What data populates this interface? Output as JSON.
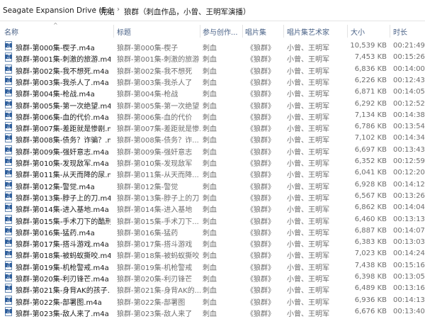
{
  "breadcrumb": [
    "Seagate Expansion Drive (E:)",
    "完结",
    "狼群（刺血作品，小曾、王明军演播）"
  ],
  "breadcrumb_separator": "›",
  "columns": {
    "name": "名称",
    "title": "标题",
    "artist": "参与创作...",
    "album": "唱片集",
    "album_artist": "唱片集艺术家",
    "size": "大小",
    "length": "时长",
    "sort_indicator": "^"
  },
  "icon": "audio-file-icon",
  "accent": "#2f5f9c",
  "files": [
    {
      "name": "狼群-第000集-楔子.m4a",
      "title": "狼群-第000集-楔子",
      "artist": "刺血",
      "album": "《狼群》",
      "album_artist": "小曾、王明军",
      "size": "10,539 KB",
      "length": "00:21:49"
    },
    {
      "name": "狼群-第001集-刺激的旅游.m4a",
      "title": "狼群-第001集-刺激的旅游",
      "artist": "刺血",
      "album": "《狼群》",
      "album_artist": "小曾、王明军",
      "size": "7,453 KB",
      "length": "00:15:26"
    },
    {
      "name": "狼群-第002集-我不想死.m4a",
      "title": "狼群-第002集-我不想死",
      "artist": "刺血",
      "album": "《狼群》",
      "album_artist": "小曾、王明军",
      "size": "6,836 KB",
      "length": "00:14:00"
    },
    {
      "name": "狼群-第003集-我杀人了.m4a",
      "title": "狼群-第003集-我杀人了",
      "artist": "刺血",
      "album": "《狼群》",
      "album_artist": "小曾、王明军",
      "size": "6,226 KB",
      "length": "00:12:43"
    },
    {
      "name": "狼群-第004集-枪战.m4a",
      "title": "狼群-第004集-枪战",
      "artist": "刺血",
      "album": "《狼群》",
      "album_artist": "小曾、王明军",
      "size": "6,871 KB",
      "length": "00:14:05"
    },
    {
      "name": "狼群-第005集-第一次绝望.m4a",
      "title": "狼群-第005集-第一次绝望",
      "artist": "刺血",
      "album": "《狼群》",
      "album_artist": "小曾、王明军",
      "size": "6,292 KB",
      "length": "00:12:52"
    },
    {
      "name": "狼群-第006集-血的代价.m4a",
      "title": "狼群-第006集-血的代价",
      "artist": "刺血",
      "album": "《狼群》",
      "album_artist": "小曾、王明军",
      "size": "7,134 KB",
      "length": "00:14:38"
    },
    {
      "name": "狼群-第007集-差距就是惨剧.m...",
      "title": "狼群-第007集-差距就是惨...",
      "artist": "刺血",
      "album": "《狼群》",
      "album_artist": "小曾、王明军",
      "size": "6,786 KB",
      "length": "00:13:54"
    },
    {
      "name": "狼群-第008集-债务？诈骗？.m...",
      "title": "狼群-第008集-债务？诈...",
      "artist": "刺血",
      "album": "《狼群》",
      "album_artist": "小曾、王明军",
      "size": "7,102 KB",
      "length": "00:14:34"
    },
    {
      "name": "狼群-第009集-强奸意志.m4a",
      "title": "狼群-第009集-强奸意志",
      "artist": "刺血",
      "album": "《狼群》",
      "album_artist": "小曾、王明军",
      "size": "6,697 KB",
      "length": "00:13:43"
    },
    {
      "name": "狼群-第010集-发现敌军.m4a",
      "title": "狼群-第010集-发现敌军",
      "artist": "刺血",
      "album": "《狼群》",
      "album_artist": "小曾、王明军",
      "size": "6,352 KB",
      "length": "00:12:59"
    },
    {
      "name": "狼群-第011集-从天而降的尿.m...",
      "title": "狼群-第011集-从天而降...",
      "artist": "刺血",
      "album": "《狼群》",
      "album_artist": "小曾、王明军",
      "size": "6,041 KB",
      "length": "00:12:20"
    },
    {
      "name": "狼群-第012集-警觉.m4a",
      "title": "狼群-第012集-警觉",
      "artist": "刺血",
      "album": "《狼群》",
      "album_artist": "小曾、王明军",
      "size": "6,928 KB",
      "length": "00:14:12"
    },
    {
      "name": "狼群-第013集-脖子上的刀.m4a",
      "title": "狼群-第013集-脖子上的刀",
      "artist": "刺血",
      "album": "《狼群》",
      "album_artist": "小曾、王明军",
      "size": "6,567 KB",
      "length": "00:13:26"
    },
    {
      "name": "狼群-第014集-进入基地.m4a",
      "title": "狼群-第014集-进入基地",
      "artist": "刺血",
      "album": "《狼群》",
      "album_artist": "小曾、王明军",
      "size": "6,862 KB",
      "length": "00:14:04"
    },
    {
      "name": "狼群-第015集-手术刀下的酷刑....",
      "title": "狼群-第015集-手术刀下...",
      "artist": "刺血",
      "album": "《狼群》",
      "album_artist": "小曾、王明军",
      "size": "6,460 KB",
      "length": "00:13:13"
    },
    {
      "name": "狼群-第016集-猛药.m4a",
      "title": "狼群-第016集-猛药",
      "artist": "刺血",
      "album": "《狼群》",
      "album_artist": "小曾、王明军",
      "size": "6,887 KB",
      "length": "00:14:07"
    },
    {
      "name": "狼群-第017集-搭斗游戏.m4a",
      "title": "狼群-第017集-搭斗游戏",
      "artist": "刺血",
      "album": "《狼群》",
      "album_artist": "小曾、王明军",
      "size": "6,383 KB",
      "length": "00:13:03"
    },
    {
      "name": "狼群-第018集-被蚂蚁撕咬.m4a",
      "title": "狼群-第018集-被蚂蚁撕咬",
      "artist": "刺血",
      "album": "《狼群》",
      "album_artist": "小曾、王明军",
      "size": "7,023 KB",
      "length": "00:14:24"
    },
    {
      "name": "狼群-第019集-机枪警戒.m4a",
      "title": "狼群-第019集-机枪警戒",
      "artist": "刺血",
      "album": "《狼群》",
      "album_artist": "小曾、王明军",
      "size": "7,438 KB",
      "length": "00:15:16"
    },
    {
      "name": "狼群-第020集-利刃锋芒.m4a",
      "title": "狼群-第020集-利刃锋芒",
      "artist": "刺血",
      "album": "《狼群》",
      "album_artist": "小曾、王明军",
      "size": "6,398 KB",
      "length": "00:13:05"
    },
    {
      "name": "狼群-第021集-身背AK的孩子....",
      "title": "狼群-第021集-身背AK的...",
      "artist": "刺血",
      "album": "《狼群》",
      "album_artist": "小曾、王明军",
      "size": "6,489 KB",
      "length": "00:13:16"
    },
    {
      "name": "狼群-第022集-部署图.m4a",
      "title": "狼群-第022集-部署图",
      "artist": "刺血",
      "album": "《狼群》",
      "album_artist": "小曾、王明军",
      "size": "6,936 KB",
      "length": "00:14:13"
    },
    {
      "name": "狼群-第023集-敌人来了.m4a",
      "title": "狼群-第023集-敌人来了",
      "artist": "刺血",
      "album": "《狼群》",
      "album_artist": "小曾、王明军",
      "size": "6,676 KB",
      "length": "00:13:40"
    }
  ]
}
